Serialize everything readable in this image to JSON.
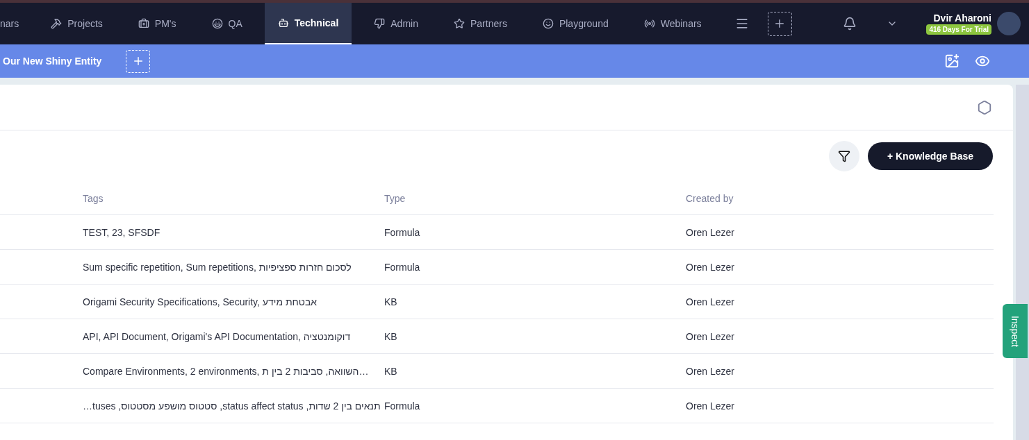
{
  "nav": {
    "tabs": [
      {
        "label": "nars",
        "selected": false
      },
      {
        "label": "Projects",
        "selected": false
      },
      {
        "label": "PM's",
        "selected": false
      },
      {
        "label": "QA",
        "selected": false
      },
      {
        "label": "Technical",
        "selected": true
      },
      {
        "label": "Admin",
        "selected": false
      },
      {
        "label": "Partners",
        "selected": false
      },
      {
        "label": "Playground",
        "selected": false
      },
      {
        "label": "Webinars",
        "selected": false
      }
    ],
    "user": {
      "name": "Dvir Aharoni",
      "badge": "416 Days For Trial"
    }
  },
  "entity_bar": {
    "entity": "Our New Shiny Entity"
  },
  "toolbar": {
    "add_button": "+ Knowledge Base"
  },
  "table": {
    "columns": [
      "Tags",
      "Type",
      "Created by"
    ],
    "rows": [
      [
        "TEST, 23, SFSDF",
        "Formula",
        "Oren Lezer"
      ],
      [
        "Sum specific repetition, Sum repetitions, לסכום חזרות ספציפיות",
        "Formula",
        "Oren Lezer"
      ],
      [
        "Origami Security Specifications, Security, אבטחת מידע",
        "KB",
        "Oren Lezer"
      ],
      [
        "API, API Document, Origami's API Documentation, דוקומנטציה",
        "KB",
        "Oren Lezer"
      ],
      [
        "Compare Environments, 2 environments, השוואה, סביבות 2 בין ת…",
        "KB",
        "Oren Lezer"
      ],
      [
        "תנאים בין 2 שדות, status affect status, סטטוס מושפע מסטטוס, tuses…",
        "Formula",
        "Oren Lezer"
      ]
    ]
  },
  "inspect_tab": {
    "label": "Inspect"
  }
}
